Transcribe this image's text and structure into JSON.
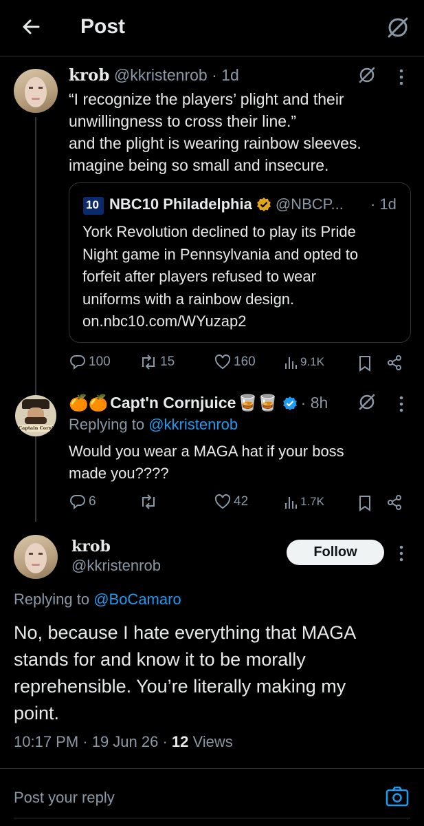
{
  "header": {
    "title": "Post"
  },
  "post1": {
    "name": "krob",
    "handle": "@kkristenrob",
    "time": "· 1d",
    "lines": [
      "“I recognize the players’ plight and their",
      "unwillingness to cross their line.”",
      "and the plight is wearing rainbow sleeves.",
      "imagine being so small and insecure."
    ],
    "quote": {
      "logo_text": "10",
      "name": "NBC10 Philadelphia",
      "handle": "@NBCP...",
      "time": "· 1d",
      "lines": [
        "York Revolution declined to play its Pride",
        "Night game in Pennsylvania and opted to",
        "forfeit after players refused to wear",
        "uniforms with a rainbow design.",
        "on.nbc10.com/WYuzap2"
      ]
    },
    "stats": {
      "replies": "100",
      "reposts": "15",
      "likes": "160",
      "views": "9.1K"
    }
  },
  "post2": {
    "name_prefix": "🍊🍊",
    "name": "Capt'n Cornjuice",
    "name_suffix": "🥃🥃",
    "time": "· 8h",
    "avatar_text": "Captain Cornjuice",
    "replying_label": "Replying to ",
    "replying_handle": "@kkristenrob",
    "lines": [
      "Would you wear a MAGA hat if your boss",
      "made you????"
    ],
    "stats": {
      "replies": "6",
      "reposts": "",
      "likes": "42",
      "views": "1.7K"
    }
  },
  "main": {
    "name": "krob",
    "handle": "@kkristenrob",
    "follow_label": "Follow",
    "replying_label": "Replying to ",
    "replying_handle": "@BoCamaro",
    "lines": [
      "No, because I hate everything that MAGA",
      "stands for and know it to be morally",
      "reprehensible. You’re literally making my",
      "point."
    ],
    "meta_time": "10:17 PM · 19 Jun 26 · ",
    "views_count": "12",
    "views_label": " Views"
  },
  "reply_bar": {
    "placeholder": "Post your reply"
  },
  "colors": {
    "background": "#000000",
    "accent": "#1d9bf0",
    "muted": "#8b98a5",
    "verified_gold": "#e2a61b"
  }
}
